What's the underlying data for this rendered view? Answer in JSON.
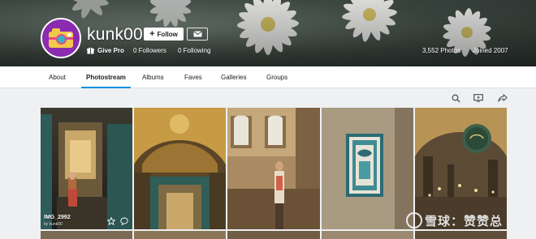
{
  "profile": {
    "username": "kunk00",
    "follow_label": "Follow",
    "give_pro_label": "Give Pro",
    "followers": "0 Followers",
    "following": "0 Following",
    "photos": "3,552 Photos",
    "joined": "Joined 2007"
  },
  "nav": {
    "items": [
      {
        "label": "About"
      },
      {
        "label": "Photostream",
        "active": true
      },
      {
        "label": "Albums"
      },
      {
        "label": "Faves"
      },
      {
        "label": "Galleries"
      },
      {
        "label": "Groups"
      }
    ]
  },
  "toolbar": {
    "icons": [
      "search-icon",
      "slideshow-icon",
      "share-icon"
    ]
  },
  "photos": [
    {
      "title": "IMG_2992",
      "by": "by kunk00"
    },
    {
      "title": ""
    },
    {
      "title": ""
    },
    {
      "title": ""
    },
    {
      "title": ""
    }
  ],
  "watermark": {
    "text": "雪球：赞赞总"
  },
  "colors": {
    "accent": "#128fdc",
    "nav_bg": "#ffffff",
    "page_bg": "#eef0f2",
    "avatar_bg": "#8a2bb0"
  }
}
